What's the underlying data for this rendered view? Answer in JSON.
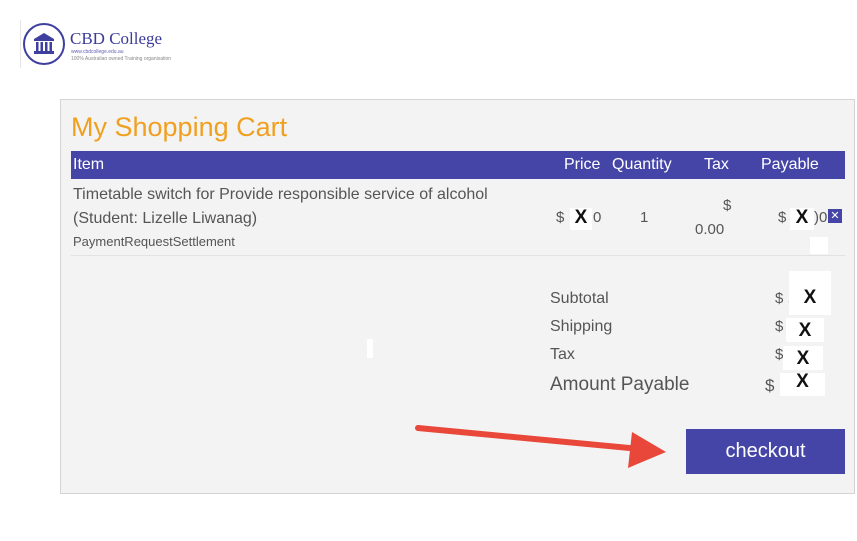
{
  "brand": {
    "name": "CBD College",
    "url": "www.cbdcollege.edu.au",
    "tagline": "100% Australian owned Training organisation",
    "accent": "#4545a8"
  },
  "cart": {
    "title": "My Shopping Cart",
    "title_color": "#f0a020",
    "columns": [
      "Item",
      "Price",
      "Quantity",
      "Tax",
      "Payable"
    ],
    "item": {
      "line1": "Timetable switch for Provide responsible service of alcohol",
      "line2": "(Student: Lizelle Liwanag)",
      "type": "PaymentRequestSettlement",
      "price_prefix": "$",
      "price_suffix": "0",
      "quantity": "1",
      "tax_prefix": "$",
      "tax_value": "0.00",
      "payable_prefix": "$",
      "payable_suffix": ")0",
      "remove_icon": "close-icon"
    },
    "redaction_mark": "X",
    "summary": {
      "subtotal_label": "Subtotal",
      "shipping_label": "Shipping",
      "tax_label": "Tax",
      "amount_label": "Amount Payable",
      "currency": "$",
      "subtotal_prefix": "$ ."
    },
    "checkout_label": "checkout",
    "annotation_arrow_color": "#e8473a"
  }
}
